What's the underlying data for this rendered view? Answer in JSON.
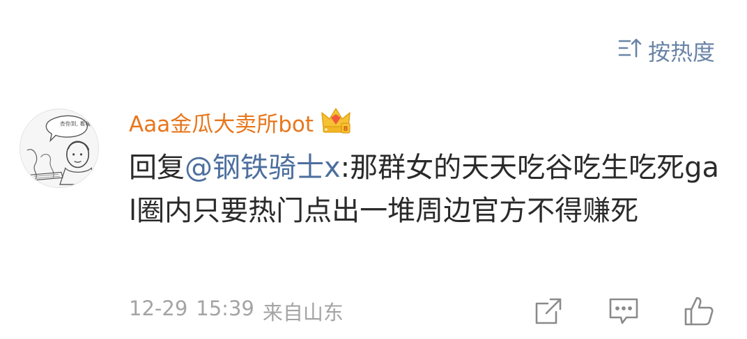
{
  "sort": {
    "label": "按热度",
    "icon": "sort-icon"
  },
  "comment": {
    "username": "Aaa金瓜大卖所bot",
    "badge_icon": "crown-badge-icon",
    "reply_prefix": "回复",
    "mention": "@钢铁骑士x",
    "text": ":那群女的天天吃谷吃生吃死gal圈内只要热门点出一堆周边官方不得赚死",
    "date": "12-29",
    "time": "15:39",
    "source": "来自山东",
    "avatar_note": "杏你到, 看暖和"
  },
  "actions": [
    {
      "name": "forward-icon"
    },
    {
      "name": "comment-icon"
    },
    {
      "name": "like-icon"
    }
  ],
  "colors": {
    "username": "#e8761c",
    "mention": "#4d6f9e",
    "meta": "#a4a4a4",
    "icon": "#8a8a8a",
    "sort": "#6a84a6"
  }
}
